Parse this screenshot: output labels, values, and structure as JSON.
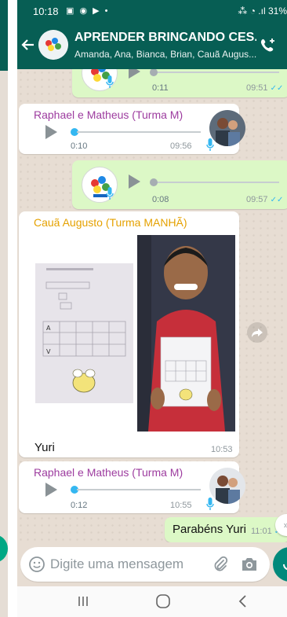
{
  "status_bar": {
    "time": "10:18",
    "indicators": "▣ ◉ ▶ •",
    "right": "⁂ ◔ .ıl 31%"
  },
  "header": {
    "title": "APRENDER BRINCANDO CES...",
    "members": "Amanda, Ana, Bianca, Brian, Cauã Augus..."
  },
  "messages": [
    {
      "kind": "audio",
      "direction": "out",
      "duration": "0:11",
      "time": "09:51",
      "ticks": "✓✓"
    },
    {
      "kind": "audio",
      "direction": "in",
      "sender": "Raphael e Matheus (Turma M)",
      "duration": "0:10",
      "time": "09:56"
    },
    {
      "kind": "audio",
      "direction": "out",
      "duration": "0:08",
      "time": "09:57",
      "ticks": "✓✓"
    },
    {
      "kind": "image",
      "direction": "in",
      "sender": "Cauã Augusto (Turma MANHÃ)",
      "caption": "Yuri",
      "time": "10:53"
    },
    {
      "kind": "audio",
      "direction": "in",
      "sender": "Raphael e Matheus (Turma M)",
      "duration": "0:12",
      "time": "10:55"
    },
    {
      "kind": "text",
      "direction": "out",
      "text": "Parabéns Yuri",
      "time": "11:01",
      "ticks": "✓✓"
    }
  ],
  "composer": {
    "placeholder": "Digite uma mensagem"
  },
  "scroll_down_label": "»",
  "icons": {
    "back": "arrow-left-icon",
    "call": "add-call-icon",
    "emoji": "emoji-icon",
    "attach": "paperclip-icon",
    "camera": "camera-icon",
    "mic": "microphone-icon",
    "forward": "forward-icon"
  },
  "colors": {
    "header": "#075e54",
    "outgoing_bubble": "#dcf8c6",
    "incoming_bubble": "#ffffff",
    "sender_purple": "#9d3c9f",
    "sender_gold": "#e5a100",
    "read_ticks": "#34b7f1",
    "fab": "#00897b"
  }
}
